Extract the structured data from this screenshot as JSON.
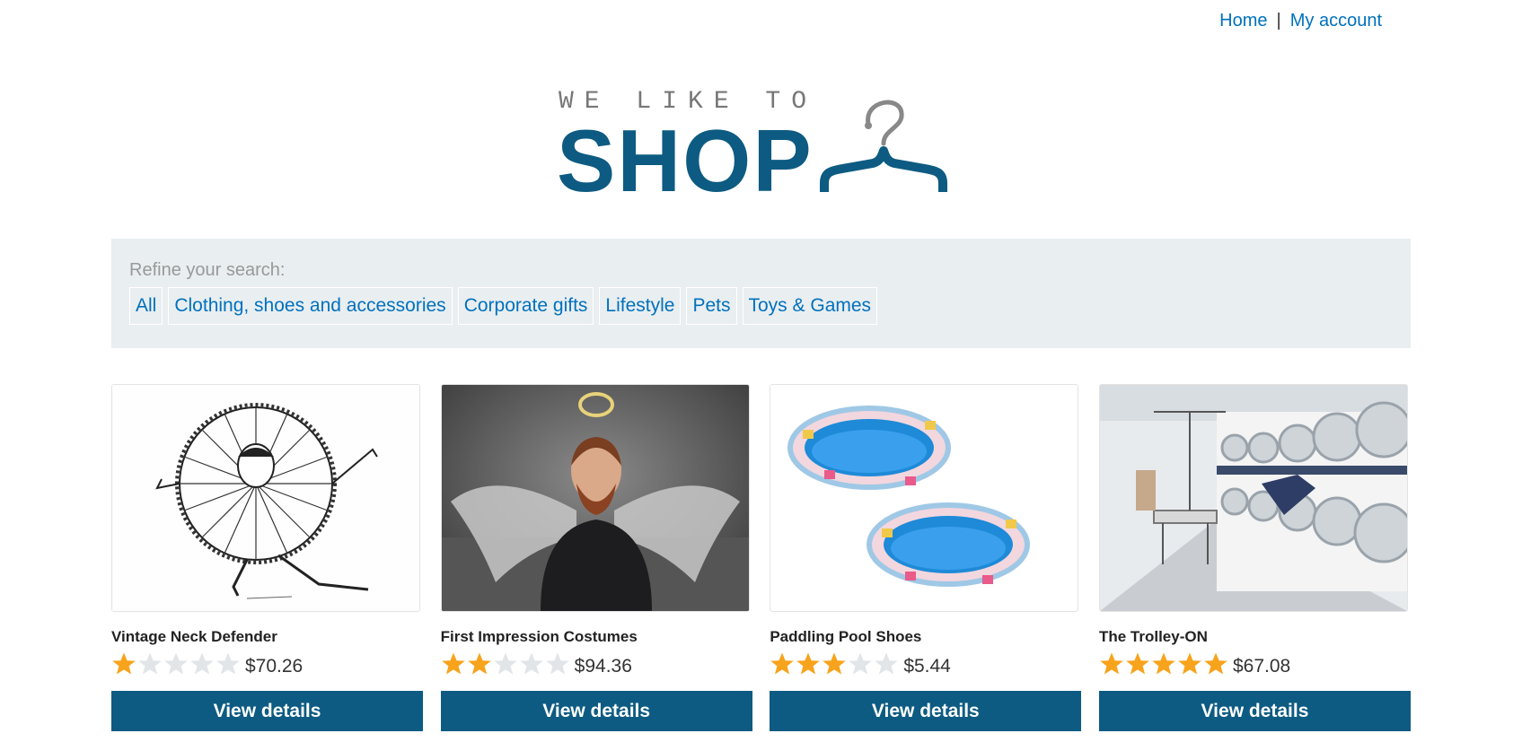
{
  "nav": {
    "home_label": "Home",
    "separator": "|",
    "account_label": "My account"
  },
  "logo": {
    "tagline": "WE LIKE TO",
    "word": "SHOP",
    "brand_color": "#0d5b82"
  },
  "filters": {
    "label": "Refine your search:",
    "items": [
      {
        "label": "All"
      },
      {
        "label": "Clothing, shoes and accessories"
      },
      {
        "label": "Corporate gifts"
      },
      {
        "label": "Lifestyle"
      },
      {
        "label": "Pets"
      },
      {
        "label": "Toys & Games"
      }
    ]
  },
  "products": [
    {
      "name": "Vintage Neck Defender",
      "rating": 1,
      "price": "$70.26",
      "button": "View details",
      "image_icon": "neck-defender-image"
    },
    {
      "name": "First Impression Costumes",
      "rating": 2,
      "price": "$94.36",
      "button": "View details",
      "image_icon": "angel-costume-image"
    },
    {
      "name": "Paddling Pool Shoes",
      "rating": 3,
      "price": "$5.44",
      "button": "View details",
      "image_icon": "pool-shoes-image"
    },
    {
      "name": "The Trolley-ON",
      "rating": 5,
      "price": "$67.08",
      "button": "View details",
      "image_icon": "laundromat-image"
    }
  ],
  "colors": {
    "star_on": "#f7a31c",
    "star_off": "#e2e5e8",
    "button_bg": "#0d5b82",
    "link": "#0071bc"
  }
}
